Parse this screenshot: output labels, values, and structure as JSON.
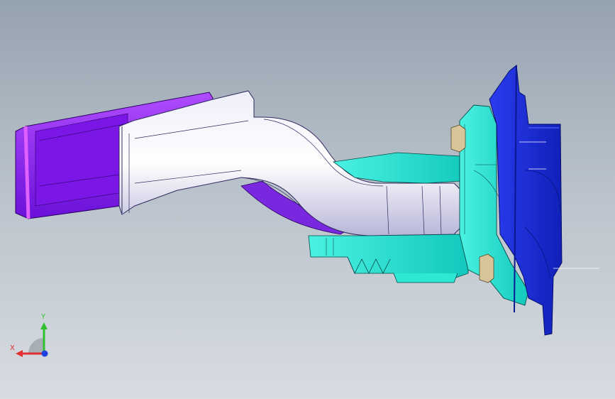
{
  "viewport": {
    "background_top": "#95a2af",
    "background_bottom": "#d7dce1"
  },
  "model": {
    "parts": [
      {
        "name": "violet-pedal-pad",
        "color": "#8a1ff0"
      },
      {
        "name": "lavender-pedal-arm",
        "color": "#d9d6f2"
      },
      {
        "name": "cyan-bracket-housing",
        "color": "#22e6d6"
      },
      {
        "name": "blue-mounting-plate",
        "color": "#1a2fd8"
      },
      {
        "name": "tan-hex-nuts",
        "color": "#c9b48c"
      }
    ]
  },
  "triad": {
    "x_label": "X",
    "y_label": "Y",
    "x_color": "#e03030",
    "y_color": "#30c030",
    "z_color": "#2040e0"
  }
}
